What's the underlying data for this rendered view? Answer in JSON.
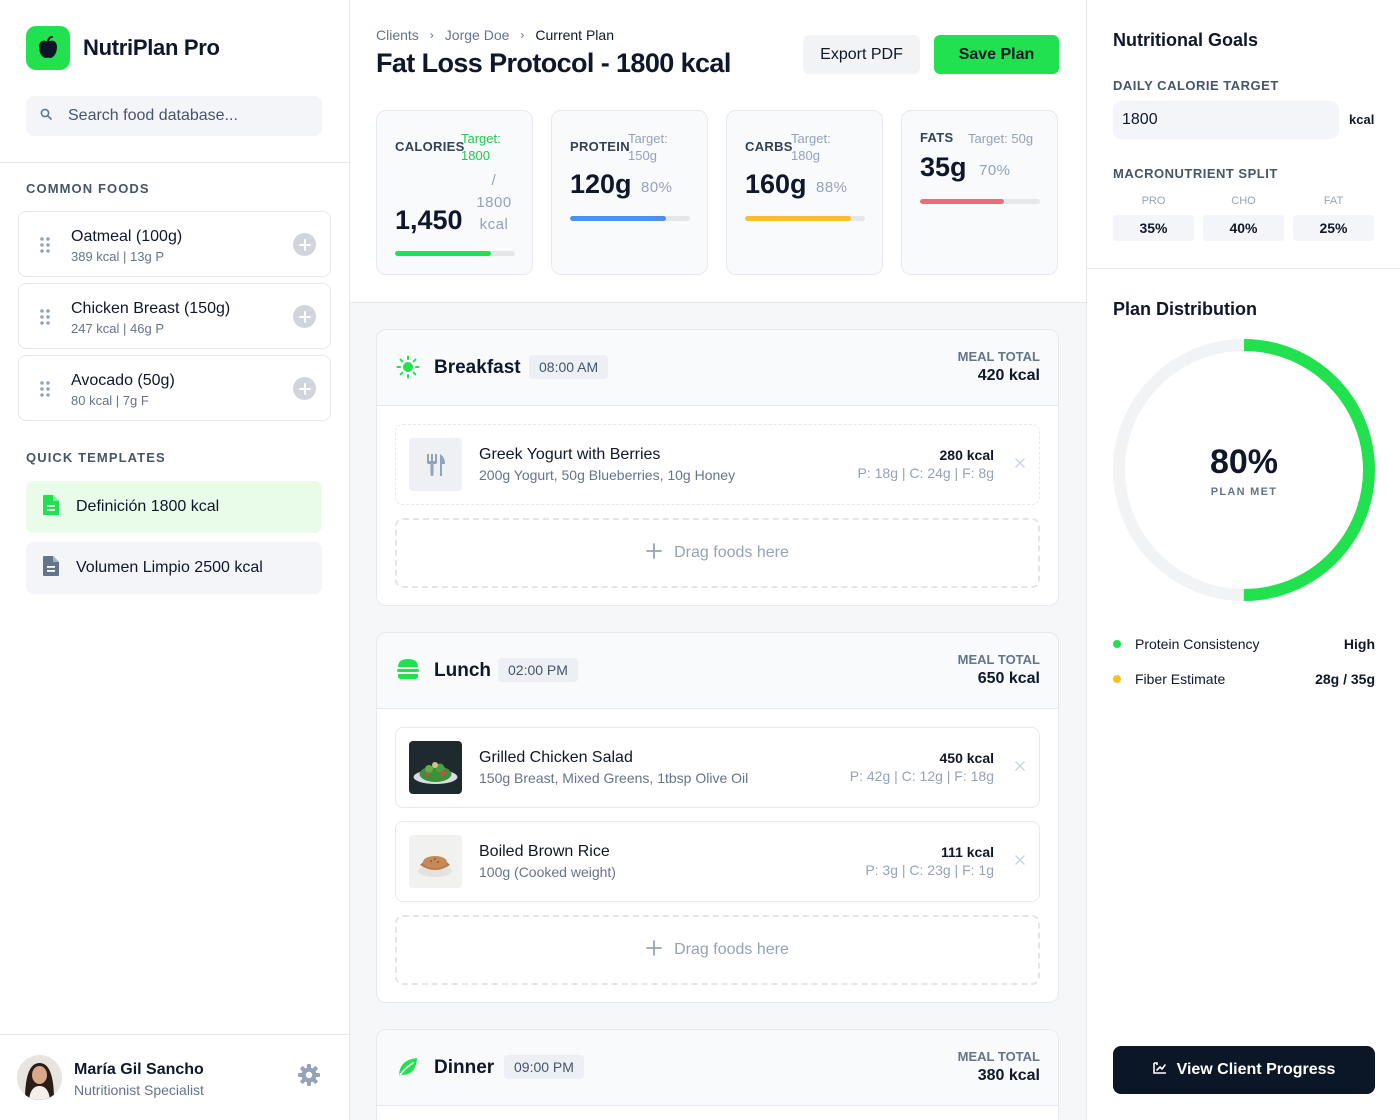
{
  "brand": {
    "name": "NutriPlan Pro"
  },
  "search": {
    "placeholder": "Search food database..."
  },
  "sidebar": {
    "common_foods_label": "COMMON FOODS",
    "foods": [
      {
        "name": "Oatmeal (100g)",
        "meta": "389 kcal | 13g P"
      },
      {
        "name": "Chicken Breast (150g)",
        "meta": "247 kcal | 46g P"
      },
      {
        "name": "Avocado (50g)",
        "meta": "80 kcal | 7g F"
      }
    ],
    "templates_label": "QUICK TEMPLATES",
    "templates": [
      {
        "label": "Definición 1800 kcal",
        "active": true
      },
      {
        "label": "Volumen Limpio 2500 kcal",
        "active": false
      }
    ]
  },
  "user": {
    "name": "María Gil Sancho",
    "role": "Nutritionist Specialist"
  },
  "breadcrumb": [
    "Clients",
    "Jorge Doe",
    "Current Plan"
  ],
  "header": {
    "title": "Fat Loss Protocol - 1800 kcal",
    "export_label": "Export PDF",
    "save_label": "Save Plan"
  },
  "stats": [
    {
      "label": "CALORIES",
      "target_label": "Target:",
      "target_value": "1800",
      "value": "1,450",
      "value_suffix": "/ 1800 kcal",
      "progress": 0.8,
      "color": "#22e14f"
    },
    {
      "label": "PROTEIN",
      "target_label": "Target:",
      "target_value": "150g",
      "value": "120g",
      "percent": "80%",
      "progress": 0.8,
      "color": "#4f8ff0"
    },
    {
      "label": "CARBS",
      "target_label": "Target:",
      "target_value": "180g",
      "value": "160g",
      "percent": "88%",
      "progress": 0.88,
      "color": "#f5c02a"
    },
    {
      "label": "FATS",
      "target_label": "Target: 50g",
      "value": "35g",
      "percent": "70%",
      "progress": 0.7,
      "color": "#f16a7a"
    }
  ],
  "meals": [
    {
      "name": "Breakfast",
      "time": "08:00 AM",
      "icon": "sun-icon",
      "total_label": "MEAL TOTAL",
      "total": "420 kcal",
      "items": [
        {
          "name": "Greek Yogurt with Berries",
          "desc": "200g Yogurt, 50g Blueberries, 10g Honey",
          "kcal": "280 kcal",
          "macros": "P: 18g | C: 24g | F: 8g",
          "thumb": "utensils-icon"
        }
      ],
      "drop_label": "Drag foods here"
    },
    {
      "name": "Lunch",
      "time": "02:00 PM",
      "icon": "burger-icon",
      "total_label": "MEAL TOTAL",
      "total": "650 kcal",
      "items": [
        {
          "name": "Grilled Chicken Salad",
          "desc": "150g Breast, Mixed Greens, 1tbsp Olive Oil",
          "kcal": "450 kcal",
          "macros": "P: 42g | C: 12g | F: 18g",
          "thumb": "salad-photo"
        },
        {
          "name": "Boiled Brown Rice",
          "desc": "100g (Cooked weight)",
          "kcal": "111 kcal",
          "macros": "P: 3g | C: 23g | F: 1g",
          "thumb": "rice-photo"
        }
      ],
      "drop_label": "Drag foods here"
    },
    {
      "name": "Dinner",
      "time": "09:00 PM",
      "icon": "leaf-icon",
      "total_label": "MEAL TOTAL",
      "total": "380 kcal",
      "items": []
    }
  ],
  "goals": {
    "title": "Nutritional Goals",
    "daily_label": "DAILY CALORIE TARGET",
    "daily_value": "1800",
    "unit": "kcal",
    "split_label": "MACRONUTRIENT SPLIT",
    "split": [
      {
        "name": "PRO",
        "value": "35%"
      },
      {
        "name": "CHO",
        "value": "40%"
      },
      {
        "name": "FAT",
        "value": "25%"
      }
    ]
  },
  "distribution": {
    "title": "Plan Distribution",
    "value": "80%",
    "label": "PLAN MET",
    "progress": 0.5,
    "metrics": [
      {
        "label": "Protein Consistency",
        "value": "High",
        "color": "#22e14f"
      },
      {
        "label": "Fiber Estimate",
        "value": "28g / 35g",
        "color": "#f5c02a"
      }
    ]
  },
  "cta": {
    "label": "View Client Progress"
  },
  "colors": {
    "accent": "#22e14f",
    "dark": "#0b1727"
  }
}
